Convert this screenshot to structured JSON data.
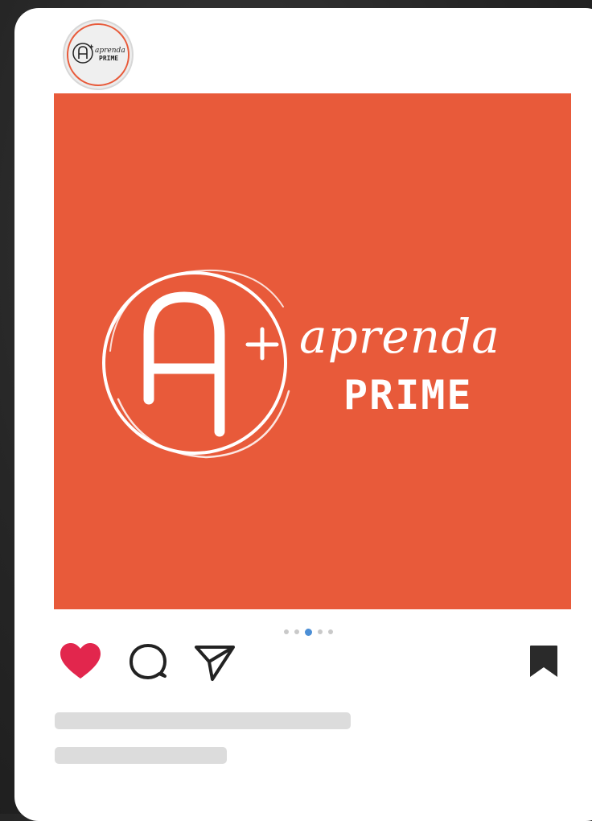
{
  "post": {
    "avatar_logo": {
      "brand_top": "aprenda",
      "brand_bottom": "PRIME",
      "mark": "A+"
    },
    "image_logo": {
      "brand_top": "aprenda",
      "brand_bottom": "PRIME",
      "mark": "A+"
    },
    "carousel": {
      "total": 5,
      "active_index": 2
    }
  },
  "actions": {
    "like_icon": "heart-icon",
    "comment_icon": "comment-icon",
    "share_icon": "send-icon",
    "save_icon": "bookmark-icon"
  },
  "colors": {
    "brand_orange": "#e85a3a",
    "like_red": "#e2264d",
    "active_dot": "#4c8fd6",
    "card_bg": "#ffffff",
    "skeleton": "#dcdcdc"
  }
}
